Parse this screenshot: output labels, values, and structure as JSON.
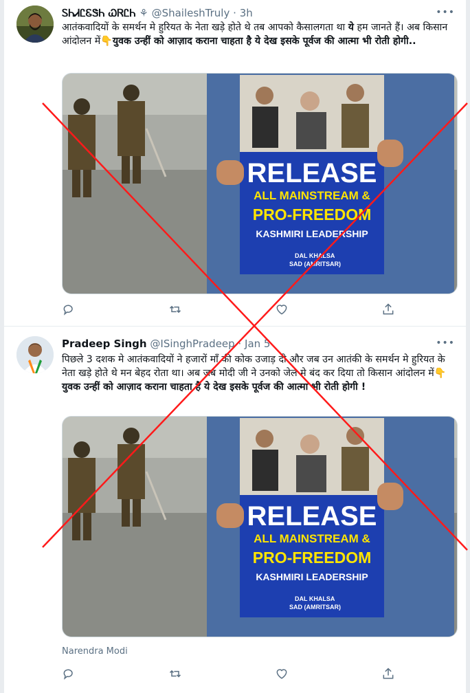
{
  "tweets": [
    {
      "name": "ᏚᏂᏗᏝᏋᏕᏂ ᏇᏒᏝᏂ",
      "verified_glyph": "⚘",
      "handle": "@ShaileshTruly",
      "dot": "·",
      "time": "3h",
      "more": "•••",
      "text_parts": [
        {
          "t": "आतंकवादियों के समर्थन मे हुरियत के नेता खड़े होते थे तब आपको कैसालगता था ",
          "b": false
        },
        {
          "t": "ये",
          "b": true
        },
        {
          "t": " हम जानते हैं। अब किसान आंदोलन में",
          "b": false
        },
        {
          "t": "👇",
          "b": false,
          "emoji": true
        },
        {
          "t": "युवक उन्हीं को आज़ाद कराना चाहता है ये देख इसके पूर्वज की आत्मा भी रोती होगी..",
          "b": true
        }
      ],
      "poster": {
        "headline": "RELEASE",
        "line2": "ALL MAINSTREAM &",
        "line3": "PRO-FREEDOM",
        "line4": "KASHMIRI LEADERSHIP",
        "org1": "DAL KHALSA",
        "org2": "SAD (AMRITSAR)"
      }
    },
    {
      "name": "Pradeep Singh",
      "handle": "@ISinghPradeep",
      "dot": "·",
      "time": "Jan 5",
      "more": "•••",
      "text_parts": [
        {
          "t": "पिछले 3 दशक मे आतंकवादियों ने हजारों माँ की कोक उजाड़ दी और जब उन आतंकी के समर्थन मे हुरियत के नेता खड़े होते थे मन बेहद रोता था। अब जब मोदी जी ने उनको जेल मे बंद कर दिया तो किसान आंदोलन में",
          "b": false
        },
        {
          "t": "👇",
          "b": false,
          "emoji": true
        },
        {
          "t": "युवक उन्हीं को आज़ाद कराना चाहता है ये देख इसके पूर्वज की आत्मा भी रोती होगी !",
          "b": true
        }
      ],
      "poster": {
        "headline": "RELEASE",
        "line2": "ALL MAINSTREAM &",
        "line3": "PRO-FREEDOM",
        "line4": "KASHMIRI LEADERSHIP",
        "org1": "DAL KHALSA",
        "org2": "SAD (AMRITSAR)"
      },
      "media_credit": "Narendra Modi"
    }
  ],
  "colors": {
    "cross": "#ff1a1a",
    "poster_blue": "#1d3fb0",
    "poster_yellow": "#ffe500",
    "muted": "#5b7083",
    "road": "#8a8c86"
  },
  "icons": [
    "reply-icon",
    "retweet-icon",
    "like-icon",
    "share-icon",
    "more-icon"
  ]
}
